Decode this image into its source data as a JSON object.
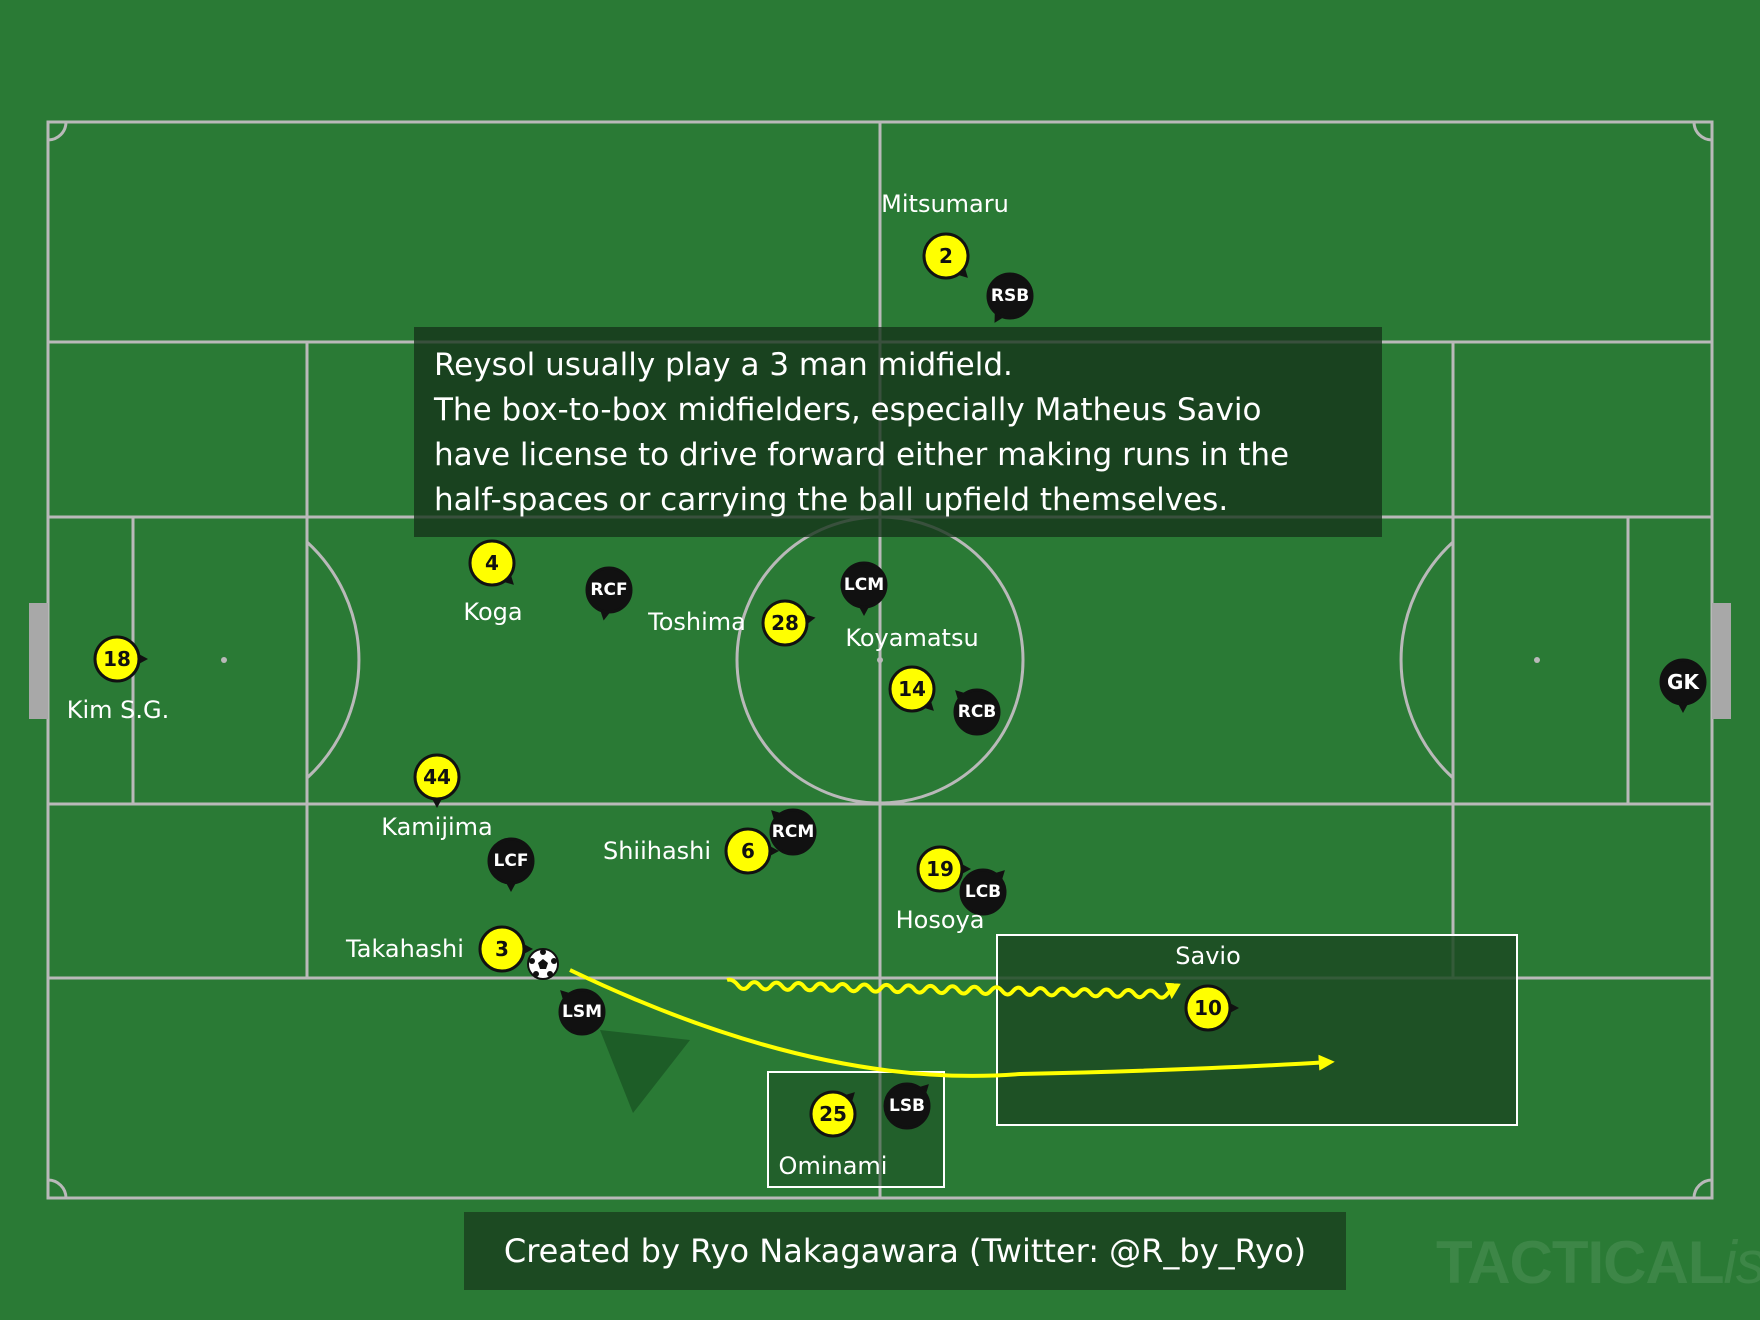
{
  "annotation": {
    "lines": [
      "Reysol usually play a 3 man midfield.",
      "The box-to-box midfielders, especially Matheus Savio",
      "have license to drive forward either making runs in the",
      "half-spaces or carrying the ball upfield themselves."
    ]
  },
  "credit": "Created by Ryo Nakagawara (Twitter: @R_by_Ryo)",
  "watermark": {
    "main": "TACTICAL",
    "suffix": "ista"
  },
  "colors": {
    "pitch": "#2a7a35",
    "lines": "#b9b9b9",
    "home_token": "#ffff00",
    "away_token": "#111111",
    "arrow": "#ffff00",
    "zone": "#1c4a22"
  },
  "zones": {
    "savio_label": "Savio"
  },
  "home_players": [
    {
      "number": "18",
      "name": "Kim S.G."
    },
    {
      "number": "4",
      "name": "Koga"
    },
    {
      "number": "28",
      "name": "Toshima"
    },
    {
      "number": "44",
      "name": "Kamijima"
    },
    {
      "number": "6",
      "name": "Shiihashi"
    },
    {
      "number": "3",
      "name": "Takahashi"
    },
    {
      "number": "2",
      "name": "Mitsumaru"
    },
    {
      "number": "14",
      "name": "Koyamatsu"
    },
    {
      "number": "19",
      "name": "Hosoya"
    },
    {
      "number": "10",
      "name": ""
    },
    {
      "number": "25",
      "name": "Ominami"
    }
  ],
  "away_players": [
    "RSB",
    "RCF",
    "LCM",
    "RCB",
    "LCF",
    "RCM",
    "LCB",
    "LSM",
    "LSB",
    "GK"
  ]
}
